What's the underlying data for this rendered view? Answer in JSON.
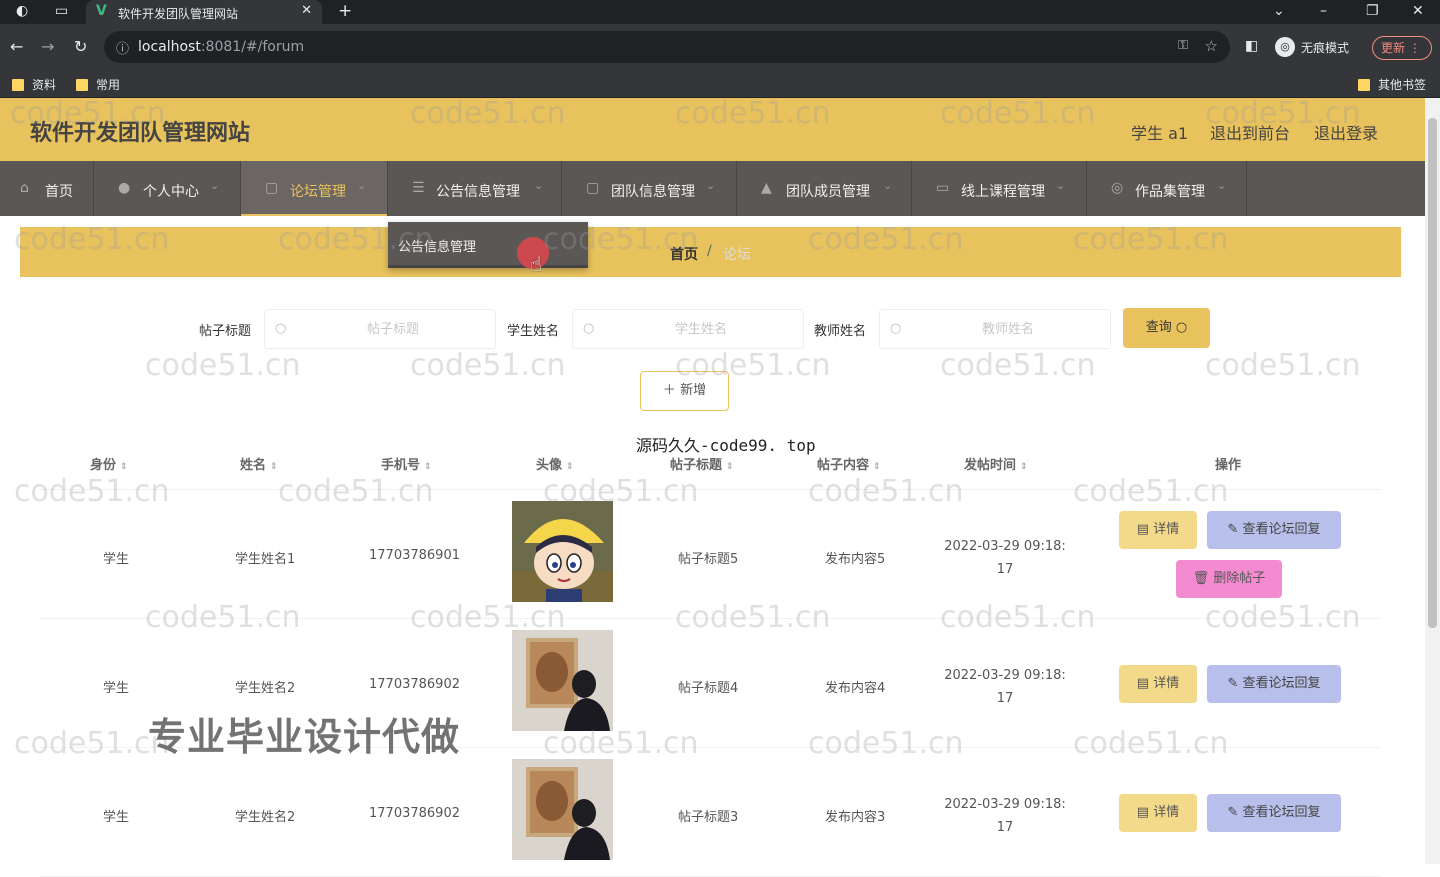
{
  "browser": {
    "tab_title": "软件开发团队管理网站",
    "tab_logo": "V",
    "url_host": "localhost",
    "url_rest": ":8081/#/forum",
    "profile_label": "无痕模式",
    "update_label": "更新",
    "bookmarks": [
      "资料",
      "常用"
    ],
    "other_bookmarks": "其他书签"
  },
  "header": {
    "site_title": "软件开发团队管理网站",
    "user": "学生 a1",
    "back_to_front": "退出到前台",
    "logout": "退出登录"
  },
  "nav": {
    "items": [
      {
        "label": "首页",
        "icon": "home-icon"
      },
      {
        "label": "个人中心",
        "icon": "user-icon"
      },
      {
        "label": "论坛管理",
        "icon": "forum-icon"
      },
      {
        "label": "公告信息管理",
        "icon": "notice-icon"
      },
      {
        "label": "团队信息管理",
        "icon": "team-icon"
      },
      {
        "label": "团队成员管理",
        "icon": "member-icon"
      },
      {
        "label": "线上课程管理",
        "icon": "course-icon"
      },
      {
        "label": "作品集管理",
        "icon": "portfolio-icon"
      }
    ],
    "dropdown_item": "公告信息管理"
  },
  "breadcrumb": {
    "home": "首页",
    "separator": "/",
    "current": "论坛"
  },
  "search": {
    "title_label": "帖子标题",
    "title_placeholder": "帖子标题",
    "student_label": "学生姓名",
    "student_placeholder": "学生姓名",
    "teacher_label": "教师姓名",
    "teacher_placeholder": "教师姓名",
    "query_button": "查询",
    "add_button": "新增"
  },
  "table": {
    "columns": [
      "身份",
      "姓名",
      "手机号",
      "头像",
      "帖子标题",
      "帖子内容",
      "发帖时间",
      "操作"
    ],
    "rows": [
      {
        "role": "学生",
        "name": "学生姓名1",
        "phone": "17703786901",
        "title": "帖子标题5",
        "content": "发布内容5",
        "time_line1": "2022-03-29 09:18:",
        "time_line2": "17",
        "avatar": "cartoon-avatar",
        "can_delete": true
      },
      {
        "role": "学生",
        "name": "学生姓名2",
        "phone": "17703786902",
        "title": "帖子标题4",
        "content": "发布内容4",
        "time_line1": "2022-03-29 09:18:",
        "time_line2": "17",
        "avatar": "photo-avatar",
        "can_delete": false
      },
      {
        "role": "学生",
        "name": "学生姓名2",
        "phone": "17703786902",
        "title": "帖子标题3",
        "content": "发布内容3",
        "time_line1": "2022-03-29 09:18:",
        "time_line2": "17",
        "avatar": "photo-avatar",
        "can_delete": false
      }
    ],
    "detail_button": "详情",
    "reply_button": "查看论坛回复",
    "delete_button": "删除帖子"
  },
  "watermarks": {
    "repeat": "code51.cn",
    "source": "源码久久-code99. top",
    "promo": "专业毕业设计代做"
  },
  "colors": {
    "accent": "#e8c25c",
    "nav_bg": "#5b5755",
    "reply_btn": "#b7bfea",
    "delete_btn": "#f48bd1"
  }
}
